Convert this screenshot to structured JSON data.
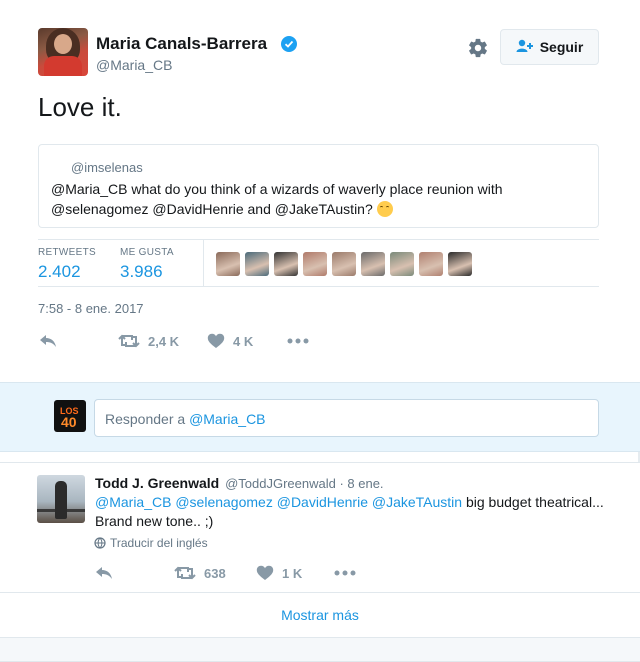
{
  "tweet": {
    "author_name": "Maria Canals-Barrera",
    "author_handle": "@Maria_CB",
    "follow_label": "Seguir",
    "text": "Love it.",
    "quote": {
      "handle": "@imselenas",
      "text": "@Maria_CB what do you think of a wizards of waverly place reunion with @selenagomez @DavidHenrie and @JakeTAustin?"
    },
    "stats": {
      "retweets_label": "RETWEETS",
      "retweets_value": "2.402",
      "likes_label": "ME GUSTA",
      "likes_value": "3.986"
    },
    "timestamp": "7:58 - 8 ene. 2017",
    "actions": {
      "retweet_count": "2,4 K",
      "like_count": "4 K"
    },
    "liker_colors": [
      "#8a6a5a",
      "#4a6a7a",
      "#333333",
      "#b07a6a",
      "#9a7a6a",
      "#6a6a6a",
      "#7a8a7a",
      "#b08070",
      "#2a2a2a"
    ]
  },
  "reply_box": {
    "placeholder_prefix": "Responder a ",
    "placeholder_mention": "@Maria_CB"
  },
  "reply": {
    "name": "Todd J. Greenwald",
    "meta": "@ToddJGreenwald · 8 ene.",
    "mentions": [
      "@Maria_CB",
      "@selenagomez",
      "@DavidHenrie",
      "@JakeTAustin"
    ],
    "text_rest": "big budget theatrical... Brand new tone..  ;)",
    "translate_label": "Traducir del inglés",
    "retweet_count": "638",
    "like_count": "1 K"
  },
  "show_more_label": "Mostrar más",
  "colors": {
    "accent": "#1b95e0",
    "muted": "#657786",
    "icon": "#8899a6",
    "reply_bar_bg": "#e8f5fd"
  }
}
